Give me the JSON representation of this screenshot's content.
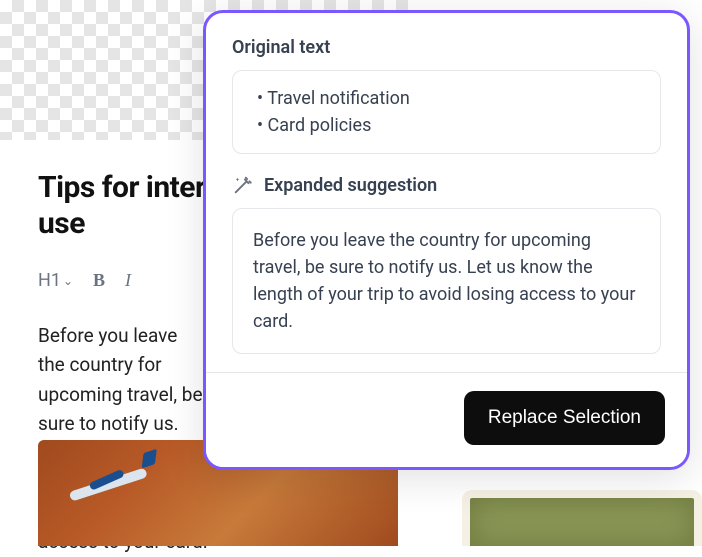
{
  "editor": {
    "title": "Tips for international card use",
    "toolbar": {
      "heading": "H1",
      "bold": "B",
      "italic": "I"
    },
    "body": "Before you leave the country for upcoming travel, be sure to notify us. Let us know the length of your trip to avoid losing access to your card."
  },
  "popover": {
    "original_label": "Original text",
    "original_items": [
      "Travel notification",
      "Card policies"
    ],
    "expanded_label": "Expanded suggestion",
    "suggestion": "Before you leave the country for upcoming travel, be sure to notify us. Let us know the length of your trip to avoid losing access to your card.",
    "replace_button": "Replace Selection"
  }
}
